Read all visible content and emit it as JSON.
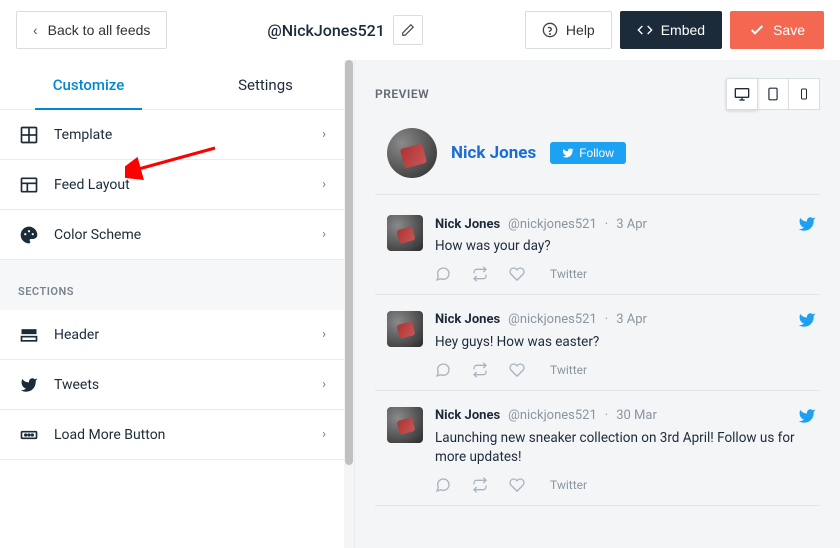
{
  "topbar": {
    "back_label": "Back to all feeds",
    "feed_title": "@NickJones521",
    "help_label": "Help",
    "embed_label": "Embed",
    "save_label": "Save"
  },
  "tabs": {
    "customize": "Customize",
    "settings": "Settings"
  },
  "menu": {
    "template": "Template",
    "feed_layout": "Feed Layout",
    "color_scheme": "Color Scheme",
    "sections_header": "SECTIONS",
    "header": "Header",
    "tweets": "Tweets",
    "load_more": "Load More Button"
  },
  "preview": {
    "label": "PREVIEW",
    "profile_name": "Nick Jones",
    "follow_label": "Follow"
  },
  "tweets": [
    {
      "name": "Nick Jones",
      "handle": "@nickjones521",
      "date": "3 Apr",
      "text": "How was your day?",
      "source": "Twitter"
    },
    {
      "name": "Nick Jones",
      "handle": "@nickjones521",
      "date": "3 Apr",
      "text": "Hey guys! How was easter?",
      "source": "Twitter"
    },
    {
      "name": "Nick Jones",
      "handle": "@nickjones521",
      "date": "30 Mar",
      "text": "Launching new sneaker collection on 3rd April! Follow us for more updates!",
      "source": "Twitter"
    }
  ]
}
